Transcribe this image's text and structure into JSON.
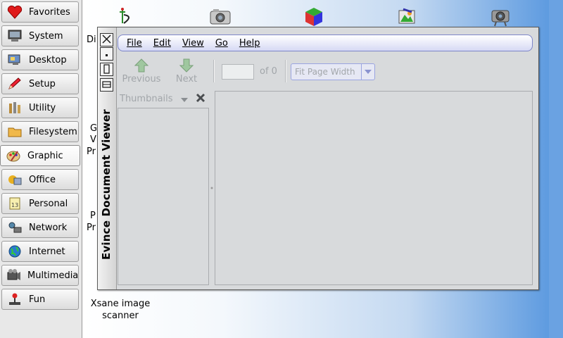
{
  "sidebar": {
    "items": [
      {
        "label": "Favorites",
        "icon": "heart-icon"
      },
      {
        "label": "System",
        "icon": "computer-icon"
      },
      {
        "label": "Desktop",
        "icon": "desktop-icon"
      },
      {
        "label": "Setup",
        "icon": "pencil-icon"
      },
      {
        "label": "Utility",
        "icon": "tools-icon"
      },
      {
        "label": "Filesystem",
        "icon": "folder-icon"
      },
      {
        "label": "Graphic",
        "icon": "palette-icon"
      },
      {
        "label": "Office",
        "icon": "office-icon"
      },
      {
        "label": "Personal",
        "icon": "calendar-icon"
      },
      {
        "label": "Network",
        "icon": "network-icon"
      },
      {
        "label": "Internet",
        "icon": "globe-icon"
      },
      {
        "label": "Multimedia",
        "icon": "multimedia-icon"
      },
      {
        "label": "Fun",
        "icon": "joystick-icon"
      }
    ],
    "active": "Graphic"
  },
  "desktop": {
    "partial_labels": [
      "Di",
      "G",
      "V",
      "Pr",
      "P",
      "Pr"
    ],
    "xsane_label_line1": "Xsane image",
    "xsane_label_line2": "scanner"
  },
  "window": {
    "title": "Evince Document Viewer",
    "menu": [
      "File",
      "Edit",
      "View",
      "Go",
      "Help"
    ],
    "toolbar": {
      "previous": "Previous",
      "next": "Next",
      "page_of": "of 0",
      "zoom": "Fit Page Width"
    },
    "sidebar_header": "Thumbnails"
  },
  "colors": {
    "accent": "#7d86c9",
    "desktop_blue": "#5e9be0",
    "disabled_text": "#a2a6aa"
  }
}
